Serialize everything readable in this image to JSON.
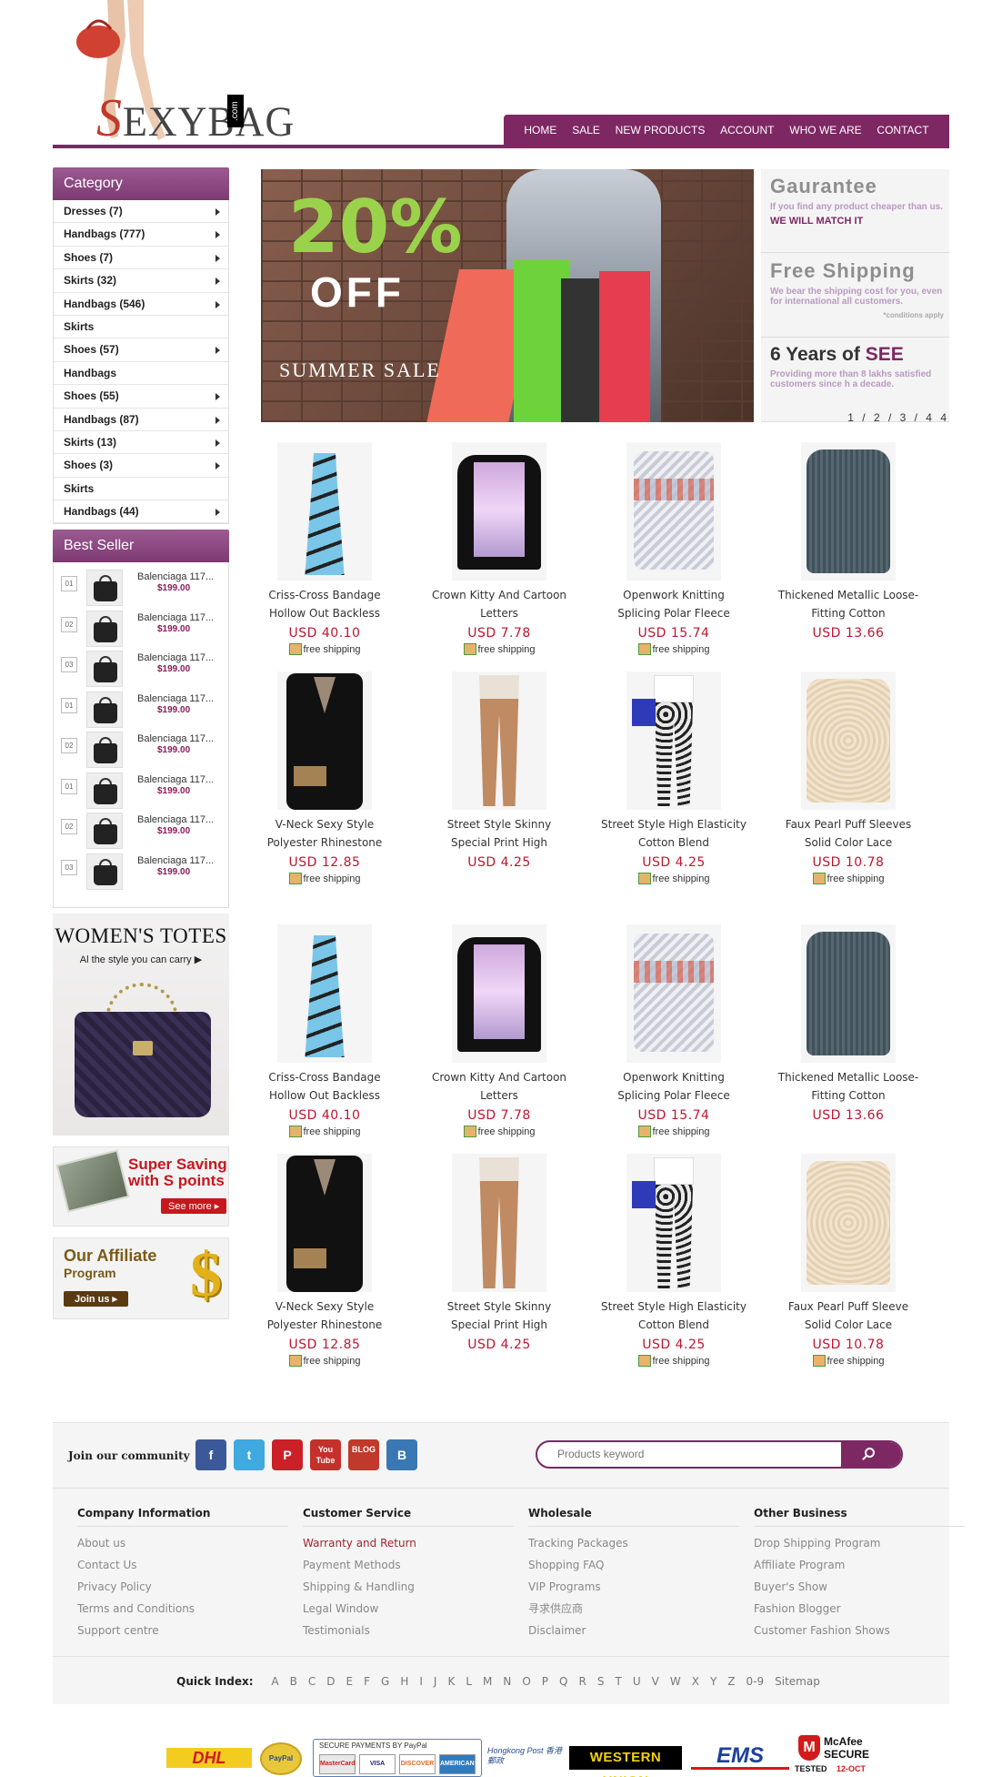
{
  "brand": {
    "name": "SEXYBAG",
    "suffix": ".com"
  },
  "nav": [
    "HOME",
    "SALE",
    "NEW PRODUCTS",
    "ACCOUNT",
    "WHO WE ARE",
    "CONTACT"
  ],
  "category": {
    "title": "Category",
    "items": [
      {
        "label": "Dresses (7)",
        "arrow": true
      },
      {
        "label": "Handbags (777)",
        "arrow": true
      },
      {
        "label": "Shoes (7)",
        "arrow": true
      },
      {
        "label": "Skirts (32)",
        "arrow": true
      },
      {
        "label": "Handbags (546)",
        "arrow": true
      },
      {
        "label": "Skirts",
        "arrow": false
      },
      {
        "label": "Shoes (57)",
        "arrow": true
      },
      {
        "label": "Handbags",
        "arrow": false
      },
      {
        "label": "Shoes (55)",
        "arrow": true
      },
      {
        "label": "Handbags (87)",
        "arrow": true
      },
      {
        "label": "Skirts (13)",
        "arrow": true
      },
      {
        "label": "Shoes (3)",
        "arrow": true
      },
      {
        "label": "Skirts",
        "arrow": false
      },
      {
        "label": "Handbags (44)",
        "arrow": true
      }
    ]
  },
  "bestseller": {
    "title": "Best Seller",
    "items": [
      {
        "rank": "01",
        "name": "Balenciaga 117...",
        "price": "$199.00"
      },
      {
        "rank": "02",
        "name": "Balenciaga 117...",
        "price": "$199.00"
      },
      {
        "rank": "03",
        "name": "Balenciaga 117...",
        "price": "$199.00"
      },
      {
        "rank": "01",
        "name": "Balenciaga 117...",
        "price": "$199.00"
      },
      {
        "rank": "02",
        "name": "Balenciaga 117...",
        "price": "$199.00"
      },
      {
        "rank": "01",
        "name": "Balenciaga 117...",
        "price": "$199.00"
      },
      {
        "rank": "02",
        "name": "Balenciaga 117...",
        "price": "$199.00"
      },
      {
        "rank": "03",
        "name": "Balenciaga 117...",
        "price": "$199.00"
      }
    ]
  },
  "side_banners": {
    "totes_title": "WOMEN'S TOTES",
    "totes_sub": "Al the style you can carry ▶",
    "saving_title": "Super Saving with S points",
    "saving_more": "See more ▸",
    "affiliate_title": "Our Affiliate",
    "affiliate_sub": "Program",
    "affiliate_join": "Join us ▸"
  },
  "banner": {
    "percent": "20%",
    "off": "OFF",
    "caption": "SUMMER SALE"
  },
  "promo": {
    "g_head": "Gaurantee",
    "g_text": "If you find any product cheaper than us.",
    "g_match": "WE WILL MATCH IT",
    "f_head": "Free Shipping",
    "f_text": "We bear the shipping cost for you, even for international all customers.",
    "f_small": "*conditions apply",
    "y_head_num": "6",
    "y_head_text": "Years of",
    "y_head_s": "SEE",
    "y_text": "Providing more than 8 lakhs satisfied customers since h a decade.",
    "pager": "1 / 2 / 3 / 4 4"
  },
  "products": [
    {
      "name": "Criss-Cross Bandage Hollow Out Backless",
      "price": "USD 40.10",
      "ship": "free shipping",
      "img": "dress"
    },
    {
      "name": "Crown Kitty And Cartoon Letters",
      "price": "USD 7.78",
      "ship": "free shipping",
      "img": "sweat"
    },
    {
      "name": "Openwork Knitting Splicing Polar Fleece",
      "price": "USD 15.74",
      "ship": "free shipping",
      "img": "knit"
    },
    {
      "name": "Thickened Metallic Loose-Fitting Cotton",
      "price": "USD 13.66",
      "ship": "",
      "img": "gray"
    },
    {
      "name": "V-Neck Sexy Style Polyester Rhinestone",
      "price": "USD 12.85",
      "ship": "free shipping",
      "img": "vneck"
    },
    {
      "name": "Street Style Skinny Special Print High",
      "price": "USD 4.25",
      "ship": "",
      "img": "skinny"
    },
    {
      "name": "Street Style High Elasticity Cotton Blend",
      "price": "USD 4.25",
      "ship": "free shipping",
      "img": "leopard"
    },
    {
      "name": "Faux Pearl Puff Sleeves Solid Color Lace",
      "price": "USD 10.78",
      "ship": "free shipping",
      "img": "lace"
    },
    {
      "name": "Criss-Cross Bandage Hollow Out Backless",
      "price": "USD 40.10",
      "ship": "free shipping",
      "img": "dress"
    },
    {
      "name": "Crown Kitty And Cartoon Letters",
      "price": "USD 7.78",
      "ship": "free shipping",
      "img": "sweat"
    },
    {
      "name": "Openwork Knitting Splicing Polar Fleece",
      "price": "USD 15.74",
      "ship": "free shipping",
      "img": "knit"
    },
    {
      "name": "Thickened Metallic Loose-Fitting Cotton",
      "price": "USD 13.66",
      "ship": "",
      "img": "gray"
    },
    {
      "name": "V-Neck Sexy Style Polyester Rhinestone",
      "price": "USD 12.85",
      "ship": "free shipping",
      "img": "vneck"
    },
    {
      "name": "Street Style Skinny Special Print High",
      "price": "USD 4.25",
      "ship": "",
      "img": "skinny"
    },
    {
      "name": "Street Style High Elasticity Cotton Blend",
      "price": "USD 4.25",
      "ship": "free shipping",
      "img": "leopard"
    },
    {
      "name": "Faux Pearl Puff Sleeve Solid Color Lace",
      "price": "USD 10.78",
      "ship": "free shipping",
      "img": "lace"
    }
  ],
  "community": {
    "label": "Join our community",
    "socials": [
      {
        "name": "facebook-icon",
        "glyph": "f",
        "color": "#3b5998"
      },
      {
        "name": "twitter-icon",
        "glyph": "t",
        "color": "#3fa9e0"
      },
      {
        "name": "pinterest-icon",
        "glyph": "P",
        "color": "#cb2027"
      },
      {
        "name": "youtube-icon",
        "glyph": "You Tube",
        "color": "#c4302b"
      },
      {
        "name": "blog-icon",
        "glyph": "BLOG",
        "color": "#c0392b"
      },
      {
        "name": "b-icon",
        "glyph": "B",
        "color": "#3a78b4"
      }
    ],
    "search_placeholder": "Products keyword"
  },
  "footer_cols": [
    {
      "title": "Company Information",
      "links": [
        "About us",
        "Contact Us",
        "Privacy Policy",
        "Terms and Conditions",
        "Support centre"
      ]
    },
    {
      "title": "Customer Service",
      "links": [
        "Warranty and Return",
        "Payment Methods",
        "Shipping & Handling",
        "Legal Window",
        "Testimonials"
      ]
    },
    {
      "title": "Wholesale",
      "links": [
        "Tracking Packages",
        "Shopping FAQ",
        "VIP Programs",
        "寻求供应商",
        "Disclaimer"
      ]
    },
    {
      "title": "Other Business",
      "links": [
        "Drop Shipping Program",
        "Affiliate Program",
        "Buyer's Show",
        "Fashion Blogger",
        "Customer Fashion Shows"
      ]
    }
  ],
  "quick_index": {
    "label": "Quick Index:",
    "letters": [
      "A",
      "B",
      "C",
      "D",
      "E",
      "F",
      "G",
      "H",
      "I",
      "J",
      "K",
      "L",
      "M",
      "N",
      "O",
      "P",
      "Q",
      "R",
      "S",
      "T",
      "U",
      "V",
      "W",
      "X",
      "Y",
      "Z",
      "0-9",
      "Sitemap"
    ]
  },
  "payments": {
    "dhl": "DHL",
    "paypal_badge": "PayPal VERIFIED",
    "secure_text": "SECURE PAYMENTS BY PayPal",
    "cards": [
      "MasterCard",
      "VISA",
      "DISCOVER",
      "AMERICAN EXPRESS"
    ],
    "hkpost": "Hongkong Post 香港郵政",
    "wu": "WESTERN UNION",
    "ems": "EMS",
    "mcafee": "McAfee SECURE",
    "tested": "TESTED",
    "date": "12-OCT"
  }
}
